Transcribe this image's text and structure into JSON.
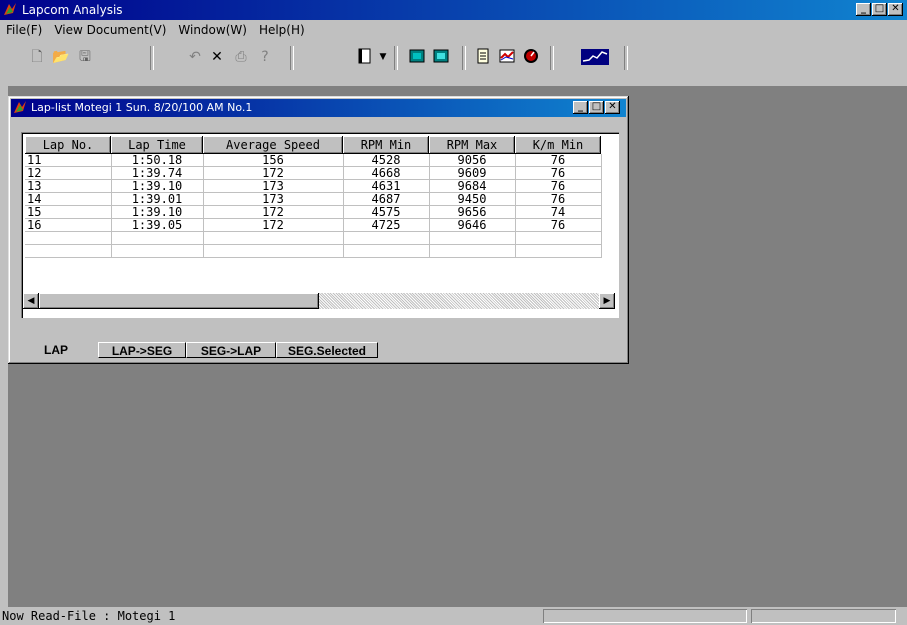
{
  "app": {
    "title": "Lapcom Analysis"
  },
  "menu": [
    "File(F)",
    "View Document(V)",
    "Window(W)",
    "Help(H)"
  ],
  "toolbar": {
    "icons": [
      "new-icon",
      "open-icon",
      "save-icon",
      "undo-icon",
      "delete-icon",
      "print-icon",
      "help-pointer-icon",
      "document-icon",
      "dropdown-icon",
      "view1-icon",
      "view2-icon",
      "sheet-icon",
      "graph-icon",
      "dial-icon",
      "chart-icon"
    ]
  },
  "child": {
    "title": "Lap-list  Motegi 1  Sun. 8/20/100 AM  No.1",
    "columns": [
      "Lap No.",
      "Lap Time",
      "Average Speed",
      "RPM Min",
      "RPM Max",
      "K/m Min"
    ],
    "rows": [
      [
        "11",
        "1:50.18",
        "156",
        "4528",
        "9056",
        "76"
      ],
      [
        "12",
        "1:39.74",
        "172",
        "4668",
        "9609",
        "76"
      ],
      [
        "13",
        "1:39.10",
        "173",
        "4631",
        "9684",
        "76"
      ],
      [
        "14",
        "1:39.01",
        "173",
        "4687",
        "9450",
        "76"
      ],
      [
        "15",
        "1:39.10",
        "172",
        "4575",
        "9656",
        "74"
      ],
      [
        "16",
        "1:39.05",
        "172",
        "4725",
        "9646",
        "76"
      ]
    ],
    "tabs": [
      "LAP",
      "LAP->SEG",
      "SEG->LAP",
      "SEG.Selected"
    ]
  },
  "status": {
    "message": "Now Read-File : Motegi 1"
  },
  "colors": {
    "titlebar": "#00008b",
    "workspace": "#808080",
    "face": "#c0c0c0"
  }
}
